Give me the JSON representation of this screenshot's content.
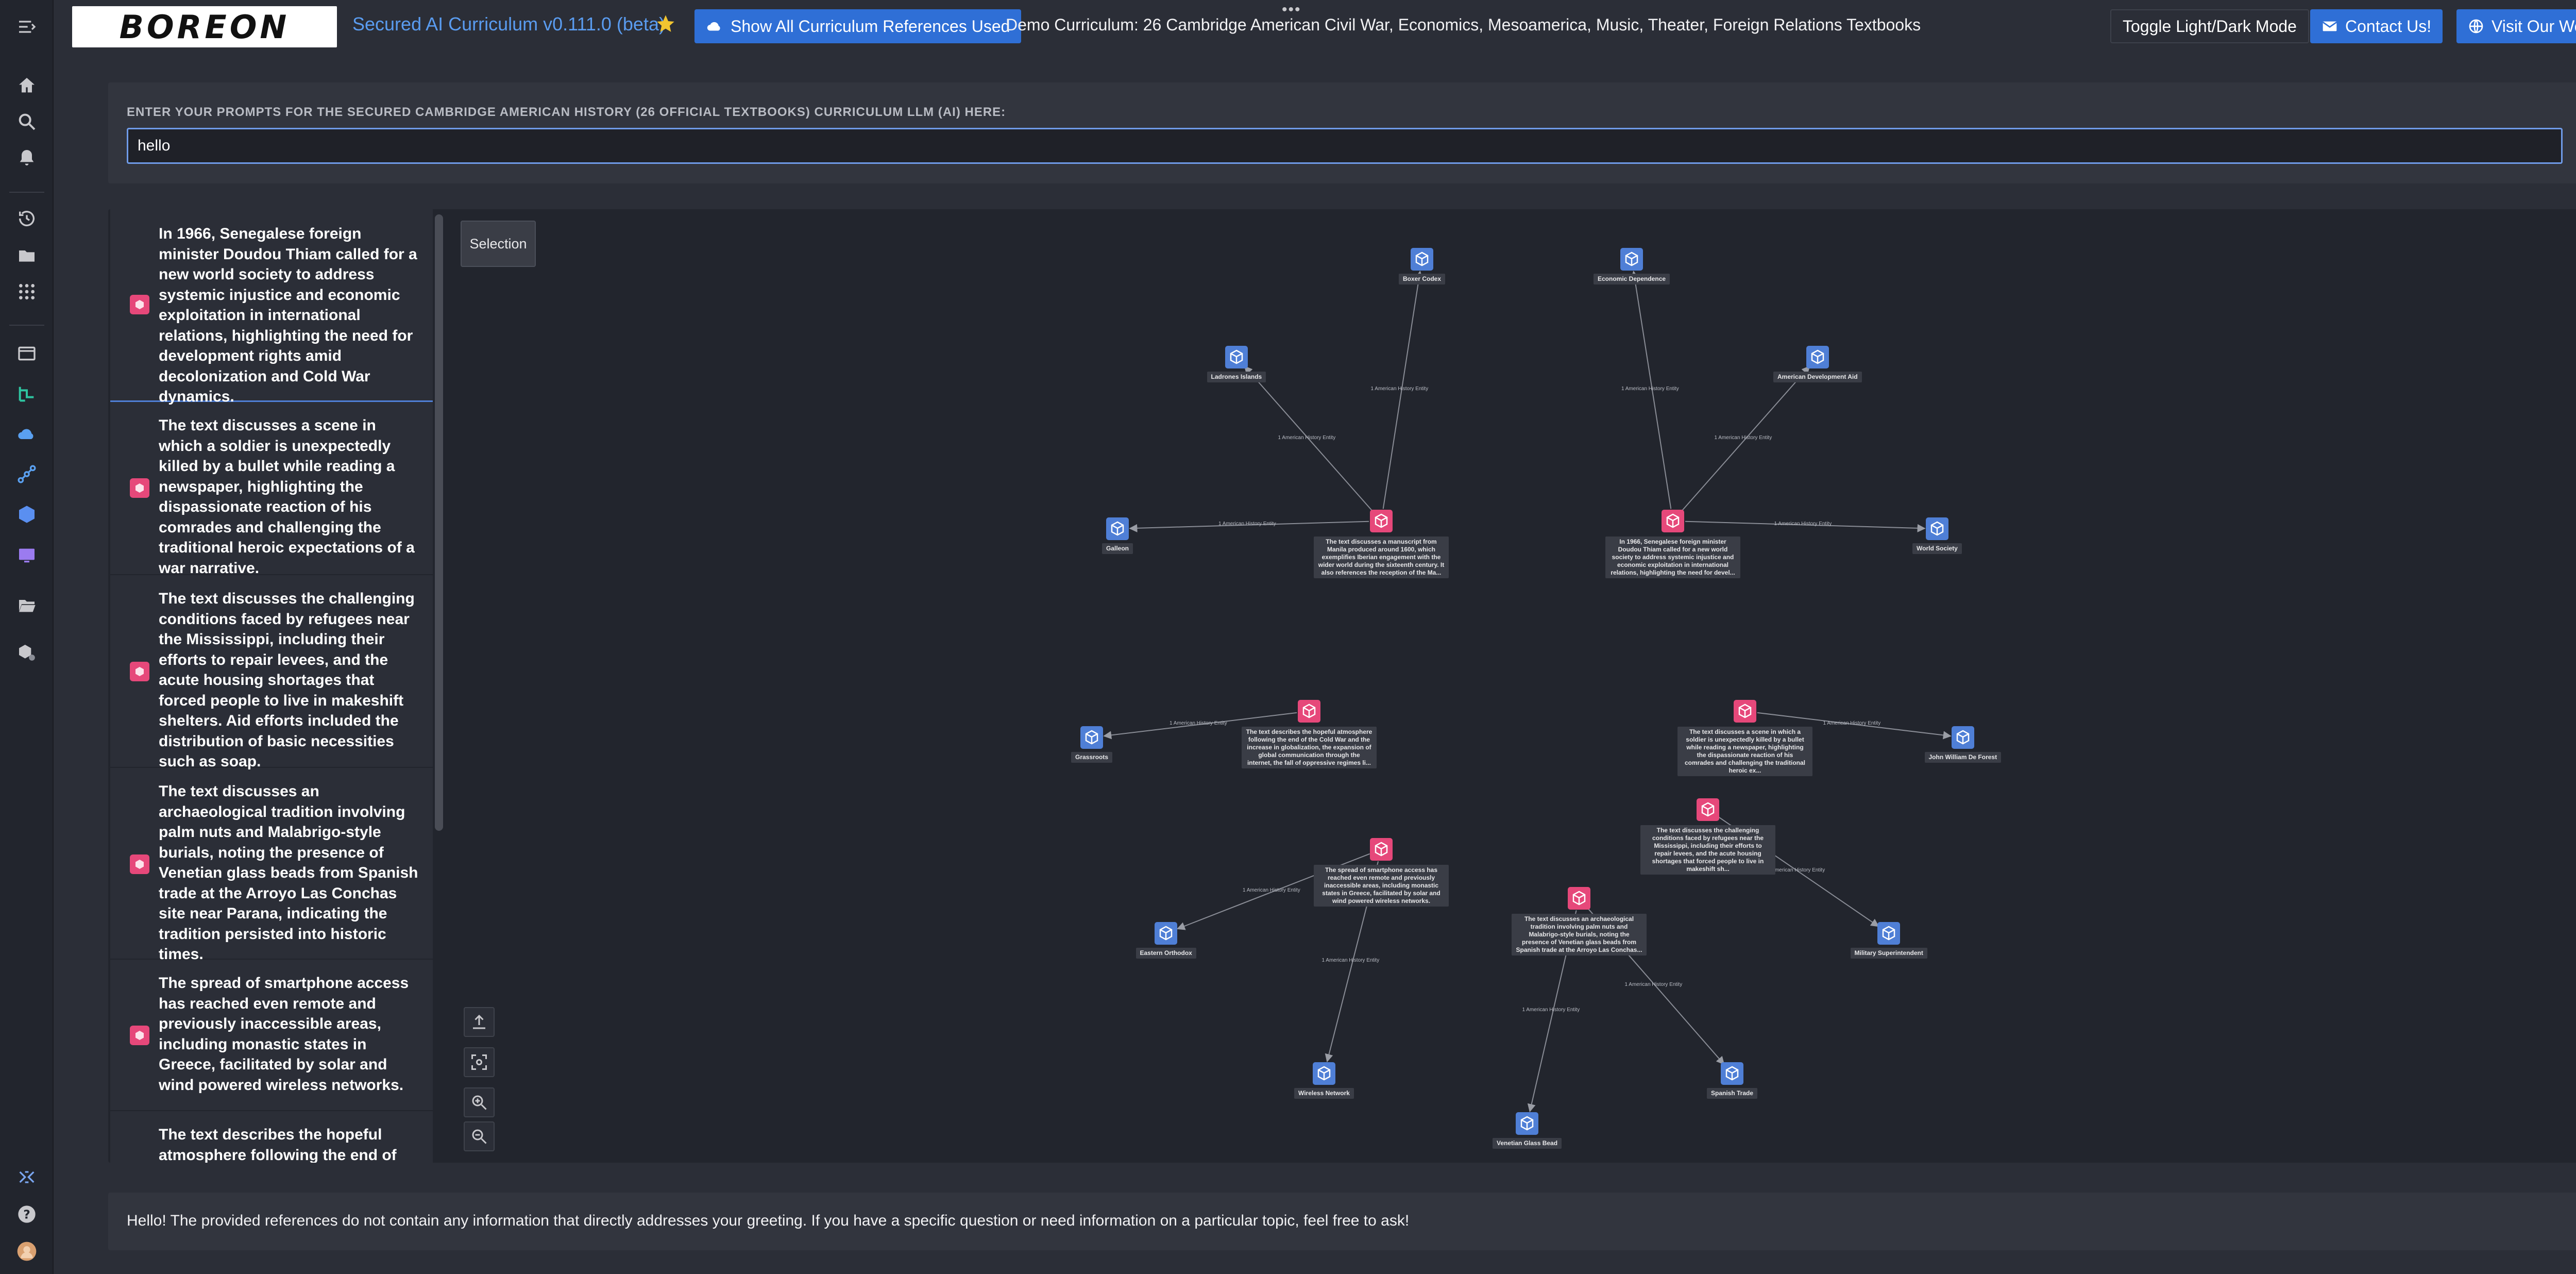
{
  "header": {
    "logo_text": "BOREON",
    "app_title": "Secured AI Curriculum v0.111.0 (beta)",
    "show_refs_label": "Show All Curriculum References Used",
    "demo_text": "Demo Curriculum: 26 Cambridge American Civil War, Economics, Mesoamerica, Music, Theater, Foreign Relations Textbooks",
    "toggle_label": "Toggle Light/Dark Mode",
    "contact_label": "Contact Us!",
    "website_label": "Visit Our Website",
    "accent_color": "#2f6fd6"
  },
  "rail": {
    "icons": [
      "menu-expand-icon",
      "home-icon",
      "search-icon",
      "bell-icon",
      "history-icon",
      "folder-icon",
      "grid-icon",
      "window-icon",
      "flow-icon",
      "cloud-icon",
      "network-icon",
      "cube-icon",
      "monitor-icon",
      "folder-open-icon",
      "cube-gear-icon",
      "double-x-icon",
      "help-icon",
      "avatar"
    ]
  },
  "prompt": {
    "label": "ENTER YOUR PROMPTS FOR THE SECURED CAMBRIDGE AMERICAN HISTORY (26 OFFICIAL TEXTBOOKS) CURRICULUM LLM (AI) HERE:",
    "value": "hello"
  },
  "list": {
    "items": [
      "In 1966, Senegalese foreign minister Doudou Thiam called for a new world society to address systemic injustice and economic exploitation in international relations, highlighting the need for development rights amid decolonization and Cold War dynamics.",
      "The text discusses a scene in which a soldier is unexpectedly killed by a bullet while reading a newspaper, highlighting the dispassionate reaction of his comrades and challenging the traditional heroic expectations of a war narrative.",
      "The text discusses the challenging conditions faced by refugees near the Mississippi, including their efforts to repair levees, and the acute housing shortages that forced people to live in makeshift shelters. Aid efforts included the distribution of basic necessities such as soap.",
      "The text discusses an archaeological tradition involving palm nuts and Malabrigo-style burials, noting the presence of Venetian glass beads from Spanish trade at the Arroyo Las Conchas site near Parana, indicating the tradition persisted into historic times.",
      "The spread of smartphone access has reached even remote and previously inaccessible areas, including monastic states in Greece, facilitated by solar and wind powered wireless networks.",
      "The text describes the hopeful atmosphere following the end of the"
    ]
  },
  "graph": {
    "selection_label": "Selection",
    "edge_label": "1 American History Entity",
    "entity_color": "#4f7fd6",
    "doc_color": "#e6487a",
    "doc_labels": [
      "The text discusses a manuscript from Manila produced around 1600, which exemplifies Iberian engagement with the wider world during the sixteenth century. It also references the reception of the Ma...",
      "In 1966, Senegalese foreign minister Doudou Thiam called for a new world society to address systemic injustice and economic exploitation in international relations, highlighting the need for devel...",
      "The text describes the hopeful atmosphere following the end of the Cold War and the increase in globalization, the expansion of global communication through the internet, the fall of oppressive regimes li...",
      "The text discusses a scene in which a soldier is unexpectedly killed by a bullet while reading a newspaper, highlighting the dispassionate reaction of his comrades and challenging the traditional heroic ex...",
      "The text discusses the challenging conditions faced by refugees near the Mississippi, including their efforts to repair levees, and the acute housing shortages that forced people to live in makeshift sh...",
      "The spread of smartphone access has reached even remote and previously inaccessible areas, including monastic states in Greece, facilitated by solar and wind powered wireless networks.",
      "The text discusses an archaeological tradition involving palm nuts and Malabrigo-style burials, noting the presence of Venetian glass beads from Spanish trade at the Arroyo Las Conchas..."
    ],
    "entity_labels": {
      "boxer_codex": "Boxer Codex",
      "economic_dependence": "Economic Dependence",
      "ladrones": "Ladrones Islands",
      "american_aid": "American Development Aid",
      "galleon": "Galleon",
      "world_society": "World Society",
      "grassroots": "Grassroots",
      "john_de_forest": "John William De Forest",
      "eastern_orthodox": "Eastern Orthodox",
      "military_super": "Military Superintendent",
      "wireless": "Wireless Network",
      "spanish_trade": "Spanish Trade",
      "venetian": "Venetian Glass Bead"
    }
  },
  "answer": {
    "text": "Hello! The provided references do not contain any information that directly addresses your greeting. If you have a specific question or need information on a particular topic, feel free to ask!"
  }
}
